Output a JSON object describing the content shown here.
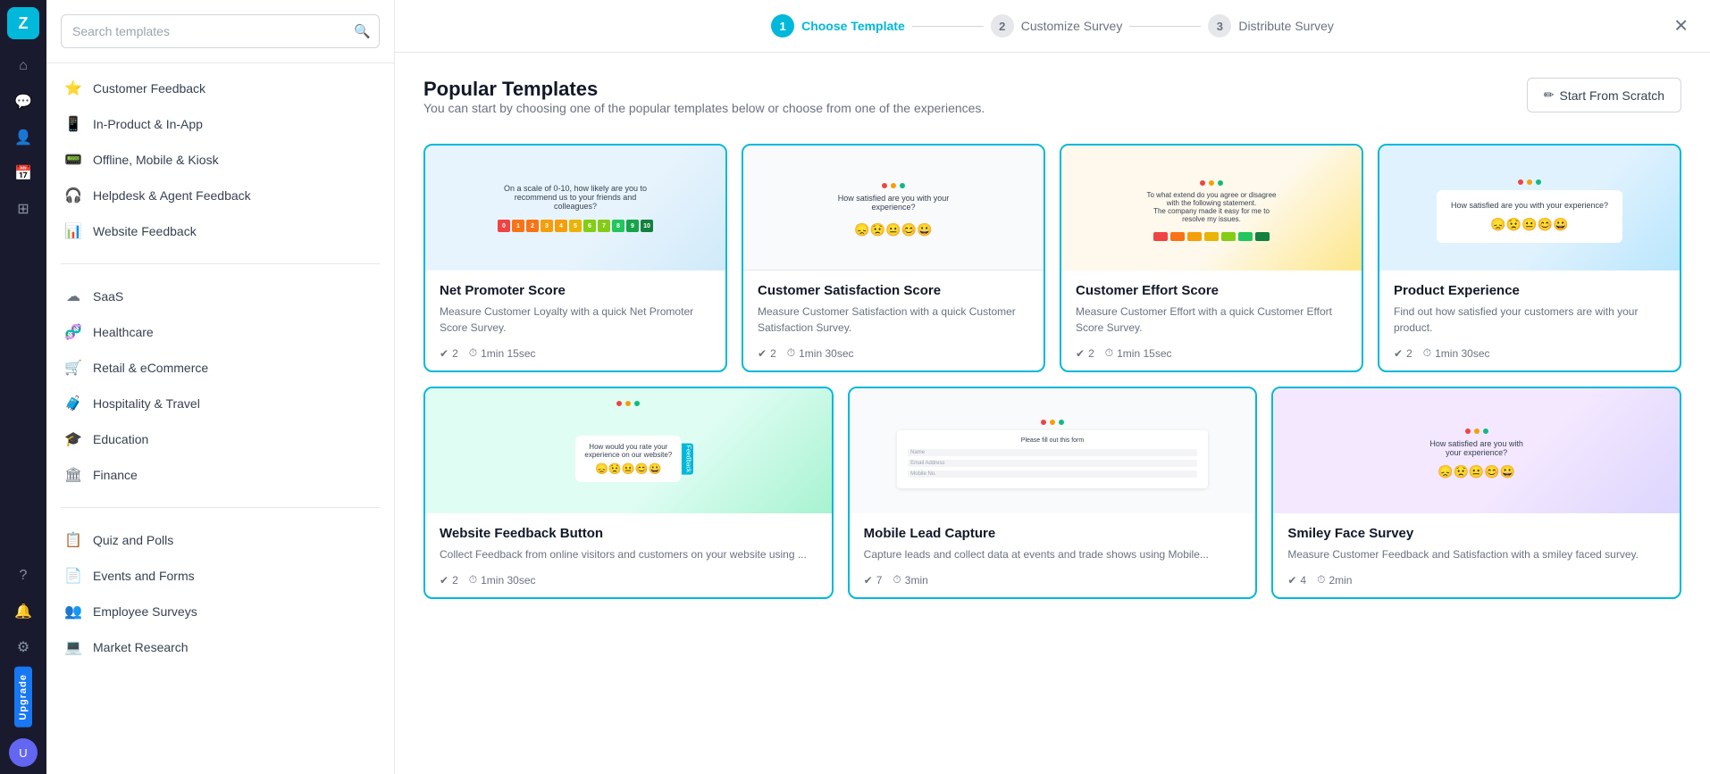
{
  "app": {
    "logo": "Z",
    "upgrade_label": "Upgrade"
  },
  "nav_rail": {
    "icons": [
      {
        "name": "home-icon",
        "symbol": "⌂",
        "active": false
      },
      {
        "name": "chat-icon",
        "symbol": "💬",
        "active": false
      },
      {
        "name": "user-icon",
        "symbol": "👤",
        "active": false
      },
      {
        "name": "calendar-icon",
        "symbol": "📅",
        "active": false
      },
      {
        "name": "grid-icon",
        "symbol": "⊞",
        "active": false
      },
      {
        "name": "help-icon",
        "symbol": "?",
        "active": false
      },
      {
        "name": "bell-icon",
        "symbol": "🔔",
        "active": false
      },
      {
        "name": "settings-icon",
        "symbol": "⚙",
        "active": false
      }
    ]
  },
  "sidebar": {
    "search_placeholder": "Search templates",
    "add_button_label": "+",
    "categories": [
      {
        "id": "customer-feedback",
        "label": "Customer Feedback",
        "icon": "⭐"
      },
      {
        "id": "in-product-in-app",
        "label": "In-Product & In-App",
        "icon": "📱"
      },
      {
        "id": "offline-mobile-kiosk",
        "label": "Offline, Mobile & Kiosk",
        "icon": "📟"
      },
      {
        "id": "helpdesk-agent-feedback",
        "label": "Helpdesk & Agent Feedback",
        "icon": "🎧"
      },
      {
        "id": "website-feedback",
        "label": "Website Feedback",
        "icon": "📊"
      }
    ],
    "industries": [
      {
        "id": "saas",
        "label": "SaaS",
        "icon": "☁"
      },
      {
        "id": "healthcare",
        "label": "Healthcare",
        "icon": "🧬"
      },
      {
        "id": "retail-ecommerce",
        "label": "Retail & eCommerce",
        "icon": "🛒"
      },
      {
        "id": "hospitality-travel",
        "label": "Hospitality & Travel",
        "icon": "🧳"
      },
      {
        "id": "education",
        "label": "Education",
        "icon": "🎓"
      },
      {
        "id": "finance",
        "label": "Finance",
        "icon": "🏛"
      }
    ],
    "others": [
      {
        "id": "quiz-polls",
        "label": "Quiz and Polls",
        "icon": "📋"
      },
      {
        "id": "events-forms",
        "label": "Events and Forms",
        "icon": "📄"
      },
      {
        "id": "employee-surveys",
        "label": "Employee Surveys",
        "icon": "👥"
      },
      {
        "id": "market-research",
        "label": "Market Research",
        "icon": "💻"
      }
    ]
  },
  "wizard": {
    "steps": [
      {
        "num": "1",
        "label": "Choose Template",
        "state": "active"
      },
      {
        "num": "2",
        "label": "Customize Survey",
        "state": "inactive"
      },
      {
        "num": "3",
        "label": "Distribute Survey",
        "state": "inactive"
      }
    ],
    "close_label": "✕"
  },
  "content": {
    "title": "Popular Templates",
    "subtitle": "You can start by choosing one of the popular templates below or choose from one of the experiences.",
    "start_scratch_label": "Start From Scratch",
    "start_scratch_icon": "✏"
  },
  "templates_row1": [
    {
      "id": "nps",
      "title": "Net Promoter Score",
      "description": "Measure Customer Loyalty with a quick Net Promoter Score Survey.",
      "questions": "2",
      "time": "1min 15sec",
      "preview_type": "nps"
    },
    {
      "id": "csat",
      "title": "Customer Satisfaction Score",
      "description": "Measure Customer Satisfaction with a quick Customer Satisfaction Survey.",
      "questions": "2",
      "time": "1min 30sec",
      "preview_type": "csat"
    },
    {
      "id": "ces",
      "title": "Customer Effort Score",
      "description": "Measure Customer Effort with a quick Customer Effort Score Survey.",
      "questions": "2",
      "time": "1min 15sec",
      "preview_type": "ces"
    },
    {
      "id": "product",
      "title": "Product Experience",
      "description": "Find out how satisfied your customers are with your product.",
      "questions": "2",
      "time": "1min 30sec",
      "preview_type": "product"
    }
  ],
  "templates_row2": [
    {
      "id": "website-feedback-btn",
      "title": "Website Feedback Button",
      "description": "Collect Feedback from online visitors and customers on your website using ...",
      "questions": "2",
      "time": "1min 30sec",
      "preview_type": "web"
    },
    {
      "id": "mobile-lead",
      "title": "Mobile Lead Capture",
      "description": "Capture leads and collect data at events and trade shows using Mobile...",
      "questions": "7",
      "time": "3min",
      "preview_type": "mobile"
    },
    {
      "id": "smiley-face",
      "title": "Smiley Face Survey",
      "description": "Measure Customer Feedback and Satisfaction with a smiley faced survey.",
      "questions": "4",
      "time": "2min",
      "preview_type": "smiley"
    }
  ]
}
